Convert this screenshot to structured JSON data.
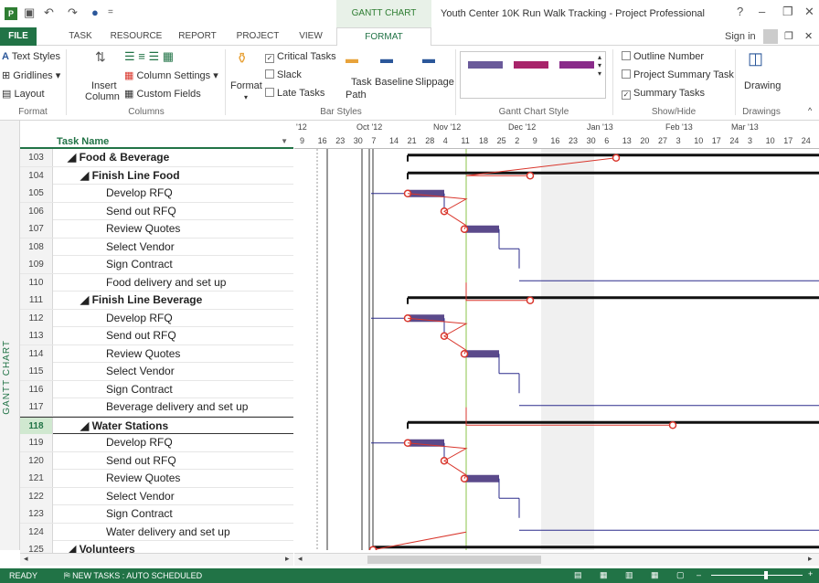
{
  "window": {
    "title": "Youth Center 10K Run Walk Tracking - Project Professional",
    "context_tab": "GANTT CHART TOOLS",
    "help": "?"
  },
  "tabs": [
    "FILE",
    "TASK",
    "RESOURCE",
    "REPORT",
    "PROJECT",
    "VIEW",
    "FORMAT"
  ],
  "active_tab": "FORMAT",
  "sign_in": "Sign in",
  "ribbon": {
    "format_group": {
      "items": [
        "Text Styles",
        "Gridlines",
        "Layout"
      ],
      "label": "Format"
    },
    "columns_group": {
      "insert": "Insert",
      "insert2": "Column",
      "col_settings": "Column Settings",
      "custom_fields": "Custom Fields",
      "label": "Columns"
    },
    "format_btn": "Format",
    "bar_styles": {
      "critical": "Critical Tasks",
      "slack": "Slack",
      "late": "Late Tasks",
      "task_path": "Task",
      "task_path2": "Path",
      "baseline": "Baseline",
      "slippage": "Slippage",
      "label": "Bar Styles"
    },
    "gantt_style_label": "Gantt Chart Style",
    "show_hide": {
      "outline": "Outline Number",
      "project_summary": "Project Summary Task",
      "summary": "Summary Tasks",
      "label": "Show/Hide"
    },
    "drawings": {
      "btn": "Drawing",
      "label": "Drawings"
    }
  },
  "side_label": "GANTT CHART",
  "grid": {
    "header": "Task Name"
  },
  "rows": [
    {
      "id": "103",
      "name": "◢ Food & Beverage",
      "level": 1,
      "bold": true
    },
    {
      "id": "104",
      "name": "◢ Finish Line Food",
      "level": 2,
      "bold": true
    },
    {
      "id": "105",
      "name": "Develop RFQ",
      "level": 3
    },
    {
      "id": "106",
      "name": "Send out RFQ",
      "level": 3
    },
    {
      "id": "107",
      "name": "Review Quotes",
      "level": 3
    },
    {
      "id": "108",
      "name": "Select Vendor",
      "level": 3
    },
    {
      "id": "109",
      "name": "Sign Contract",
      "level": 3
    },
    {
      "id": "110",
      "name": "Food delivery and set up",
      "level": 3
    },
    {
      "id": "111",
      "name": "◢ Finish Line Beverage",
      "level": 2,
      "bold": true
    },
    {
      "id": "112",
      "name": "Develop RFQ",
      "level": 3
    },
    {
      "id": "113",
      "name": "Send out RFQ",
      "level": 3
    },
    {
      "id": "114",
      "name": "Review Quotes",
      "level": 3
    },
    {
      "id": "115",
      "name": "Select Vendor",
      "level": 3
    },
    {
      "id": "116",
      "name": "Sign Contract",
      "level": 3
    },
    {
      "id": "117",
      "name": "Beverage delivery and set up",
      "level": 3
    },
    {
      "id": "118",
      "name": "◢ Water Stations",
      "level": 2,
      "bold": true,
      "selected": true
    },
    {
      "id": "119",
      "name": "Develop RFQ",
      "level": 3
    },
    {
      "id": "120",
      "name": "Send out RFQ",
      "level": 3
    },
    {
      "id": "121",
      "name": "Review Quotes",
      "level": 3
    },
    {
      "id": "122",
      "name": "Select Vendor",
      "level": 3
    },
    {
      "id": "123",
      "name": "Sign Contract",
      "level": 3
    },
    {
      "id": "124",
      "name": "Water delivery and set up",
      "level": 3
    },
    {
      "id": "125",
      "name": "◢ Volunteers",
      "level": 1,
      "bold": true
    }
  ],
  "timeline": {
    "months": [
      "'12",
      "Oct '12",
      "Nov '12",
      "Dec '12",
      "Jan '13",
      "Feb '13",
      "Mar '13"
    ],
    "days": [
      "9",
      "16",
      "23",
      "30",
      "7",
      "14",
      "21",
      "28",
      "4",
      "11",
      "18",
      "25",
      "2",
      "9",
      "16",
      "23",
      "30",
      "6",
      "13",
      "20",
      "27",
      "3",
      "10",
      "17",
      "24",
      "3",
      "10",
      "17",
      "24"
    ]
  },
  "status": {
    "ready": "READY",
    "new_tasks": "NEW TASKS : AUTO SCHEDULED"
  },
  "colors": {
    "accent": "#217346",
    "bar": "#5b4a8b",
    "critical": "#d9362c"
  }
}
